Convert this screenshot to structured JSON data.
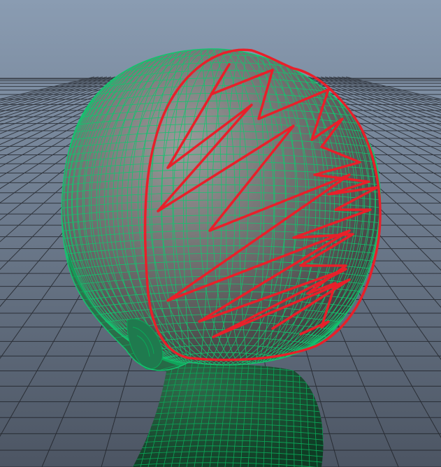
{
  "viewport": {
    "background_top": "#8a9cb2",
    "background_bottom": "#4c5563",
    "grid_color": "#1b1d22",
    "wireframe_color": "#13c46f",
    "wireframe_dense_color": "#0aa858",
    "shading_light": "#9a9a9a",
    "shading_dark": "#3a3a3a",
    "annotation_color": "#e8202a"
  },
  "model": {
    "icon": "head-mesh-icon"
  },
  "annotation": {
    "icon": "hair-region-scribble-icon"
  }
}
